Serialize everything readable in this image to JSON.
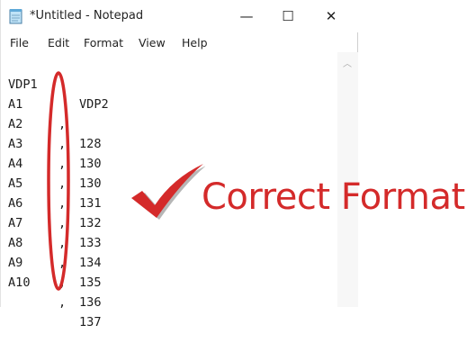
{
  "window": {
    "title": "*Untitled - Notepad",
    "controls": {
      "minimize": "—",
      "maximize": "☐",
      "close": "✕"
    }
  },
  "menu": [
    "File",
    "Edit",
    "Format",
    "View",
    "Help"
  ],
  "editor": {
    "header": {
      "col1": "VDP1",
      "col2": "VDP2"
    },
    "rows": [
      {
        "col1": "A1",
        "sep": ",",
        "col2": "128"
      },
      {
        "col1": "A2",
        "sep": ",",
        "col2": "130"
      },
      {
        "col1": "A3",
        "sep": ",",
        "col2": "130"
      },
      {
        "col1": "A4",
        "sep": ",",
        "col2": "131"
      },
      {
        "col1": "A5",
        "sep": ",",
        "col2": "132"
      },
      {
        "col1": "A6",
        "sep": ",",
        "col2": "133"
      },
      {
        "col1": "A7",
        "sep": ",",
        "col2": "134"
      },
      {
        "col1": "A8",
        "sep": ",",
        "col2": "135"
      },
      {
        "col1": "A9",
        "sep": ",",
        "col2": "136"
      },
      {
        "col1": "A10",
        "sep": ",",
        "col2": "137"
      }
    ]
  },
  "annotation": {
    "label": "Correct Format",
    "color": "#d42a2a",
    "icon": "checkmark-icon"
  }
}
